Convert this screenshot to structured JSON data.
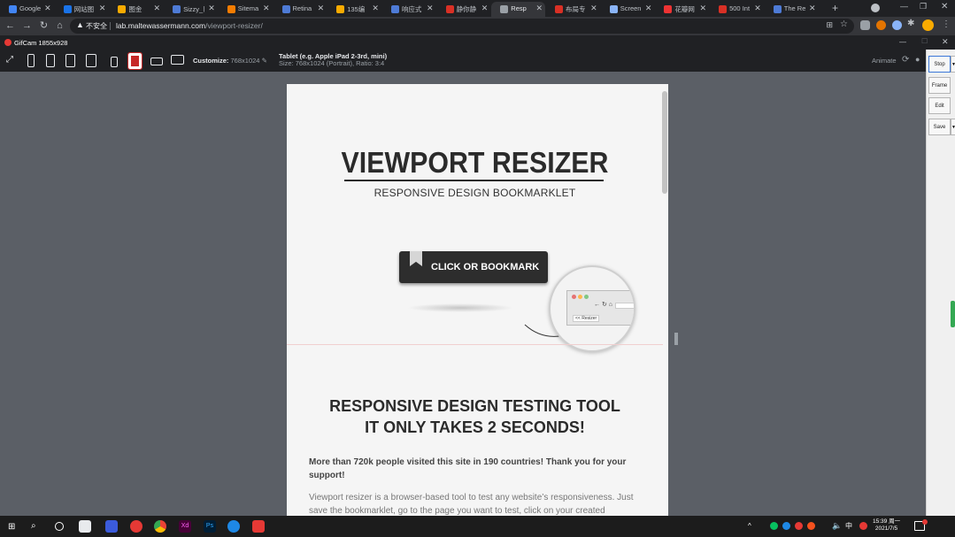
{
  "browser": {
    "tabs": [
      {
        "title": "Google",
        "fav": "#4285f4"
      },
      {
        "title": "网站图",
        "fav": "#1a73e8"
      },
      {
        "title": "图金",
        "fav": "#f9ab00"
      },
      {
        "title": "Sizzy_巨",
        "fav": "#4e7bd6"
      },
      {
        "title": "Sitema",
        "fav": "#f57c00"
      },
      {
        "title": "Retina",
        "fav": "#4e7bd6"
      },
      {
        "title": "135编",
        "fav": "#f9ab00"
      },
      {
        "title": "响应式",
        "fav": "#4e7bd6"
      },
      {
        "title": "静你静",
        "fav": "#d93025"
      },
      {
        "title": "Resp",
        "fav": "#9aa0a6"
      },
      {
        "title": "布局专",
        "fav": "#d93025"
      },
      {
        "title": "Screen",
        "fav": "#8ab4f8"
      },
      {
        "title": "花瓣网",
        "fav": "#e33"
      },
      {
        "title": "500 Int",
        "fav": "#d93025"
      },
      {
        "title": "The Re",
        "fav": "#4e7bd6"
      }
    ],
    "new_tab": "+",
    "insecure_label": "不安全",
    "url_host": "lab.maltewassermann.com",
    "url_path": "/viewport-resizer/"
  },
  "gifcam": {
    "title": "GifCam 1855x928",
    "buttons": [
      "Stop",
      "Frame",
      "Edit",
      "Save"
    ]
  },
  "toolbar": {
    "customize_label": "Customize:",
    "customize_value": "768x1024",
    "device_name": "Tablet (e.g. Apple iPad 2-3rd, mini)",
    "device_meta": "Size: 768x1024 (Portrait), Ratio: 3:4",
    "animate_label": "Animate"
  },
  "page": {
    "title": "VIEWPORT RESIZER",
    "subtitle": "RESPONSIVE DESIGN BOOKMARKLET",
    "bookmark_button": "CLICK OR BOOKMARK",
    "magnifier_label": "<< Resizer",
    "heading_line1": "RESPONSIVE DESIGN TESTING TOOL",
    "heading_line2": "IT ONLY TAKES 2 SECONDS!",
    "lead": "More than 720k people visited this site in 190 countries! Thank you for your support!",
    "body": "Viewport resizer is a browser-based tool to test any website’s responsiveness. Just save the bookmarklet, go to the page you want to test, click on your created"
  },
  "taskbar": {
    "time": "15:39 周一",
    "date": "2021/7/5",
    "ime": "中"
  }
}
